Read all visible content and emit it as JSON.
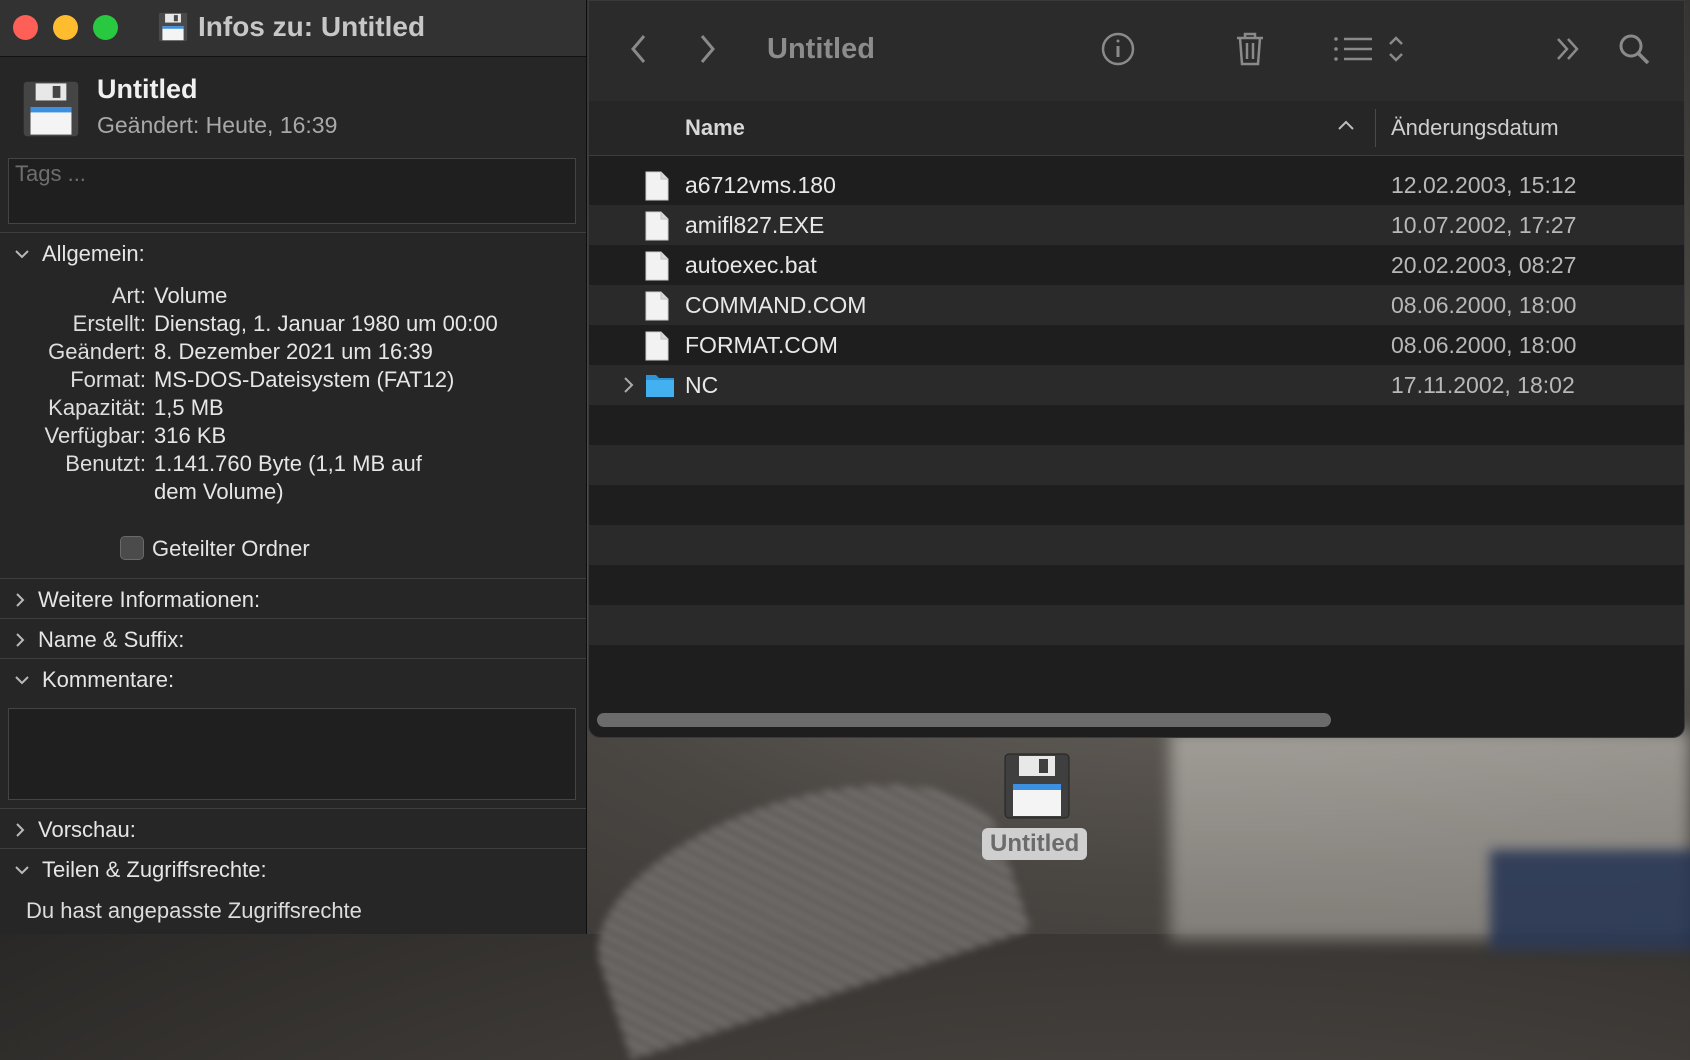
{
  "info_window": {
    "title": "Infos zu: Untitled",
    "volume_name": "Untitled",
    "modified_summary": "Geändert: Heute, 16:39",
    "tags_placeholder": "Tags ...",
    "sections": {
      "general": "Allgemein:",
      "more_info": "Weitere Informationen:",
      "name_suffix": "Name & Suffix:",
      "comments": "Kommentare:",
      "preview": "Vorschau:",
      "sharing": "Teilen & Zugriffsrechte:"
    },
    "general": [
      {
        "key": "Art:",
        "value": "Volume"
      },
      {
        "key": "Erstellt:",
        "value": "Dienstag, 1. Januar 1980 um 00:00"
      },
      {
        "key": "Geändert:",
        "value": "8. Dezember 2021 um 16:39"
      },
      {
        "key": "Format:",
        "value": "MS-DOS-Dateisystem (FAT12)"
      },
      {
        "key": "Kapazität:",
        "value": "1,5 MB"
      },
      {
        "key": "Verfügbar:",
        "value": "316 KB"
      },
      {
        "key": "Benutzt:",
        "value": "1.141.760 Byte (1,1 MB auf dem Volume)"
      }
    ],
    "shared_folder_label": "Geteilter Ordner",
    "permissions_text": "Du hast angepasste Zugriffsrechte"
  },
  "finder": {
    "title": "Untitled",
    "columns": {
      "name": "Name",
      "date": "Änderungsdatum"
    },
    "files": [
      {
        "name": "a6712vms.180",
        "date": "12.02.2003, 15:12"
      },
      {
        "name": "amifl827.EXE",
        "date": "10.07.2002, 17:27"
      },
      {
        "name": "autoexec.bat",
        "date": "20.02.2003, 08:27"
      },
      {
        "name": "COMMAND.COM",
        "date": "08.06.2000, 18:00"
      },
      {
        "name": "FORMAT.COM",
        "date": "08.06.2000, 18:00"
      },
      {
        "name": "NC",
        "date": "17.11.2002, 18:02"
      }
    ]
  },
  "desktop": {
    "icon_label": "Untitled"
  },
  "colors": {
    "close": "#fe5f57",
    "minimize": "#febc2e",
    "zoom": "#28c840",
    "folder": "#3aa6e8"
  }
}
